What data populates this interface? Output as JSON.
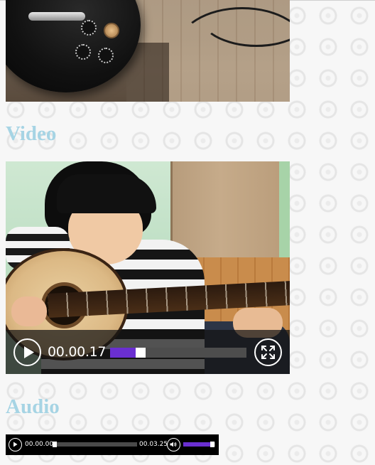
{
  "sections": {
    "video_heading": "Video",
    "audio_heading": "Audio"
  },
  "video": {
    "current_time": "00.00.17",
    "progress_fraction": 0.19,
    "play_icon": "play-icon",
    "fullscreen_icon": "fullscreen-icon"
  },
  "audio": {
    "current_time": "00.00.00",
    "duration": "00.03.25",
    "progress_fraction": 0.0,
    "volume_fraction": 0.85,
    "play_icon": "play-icon",
    "volume_icon": "volume-icon"
  },
  "colors": {
    "heading": "#a6d4e4",
    "accent": "#6a2fd1",
    "player_background": "#000000"
  }
}
